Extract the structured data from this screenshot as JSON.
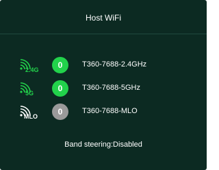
{
  "header": {
    "title": "Host WiFi"
  },
  "bands": [
    {
      "icon": "wifi-2.4ghz-icon",
      "icon_label": "2.4G",
      "client_count": "0",
      "ssid": "T360-7688-2.4GHz",
      "status_color": "#22d24b"
    },
    {
      "icon": "wifi-5ghz-icon",
      "icon_label": "5G",
      "client_count": "0",
      "ssid": "T360-7688-5GHz",
      "status_color": "#22d24b"
    },
    {
      "icon": "wifi-mlo-icon",
      "icon_label": "MLO",
      "client_count": "0",
      "ssid": "T360-7688-MLO",
      "status_color": "#9a9a9a"
    }
  ],
  "band_steering": {
    "text": "Band steering:Disabled"
  },
  "colors": {
    "panel_background": "#0c2a22",
    "active_green": "#22d24b",
    "inactive_gray": "#9a9a9a"
  }
}
